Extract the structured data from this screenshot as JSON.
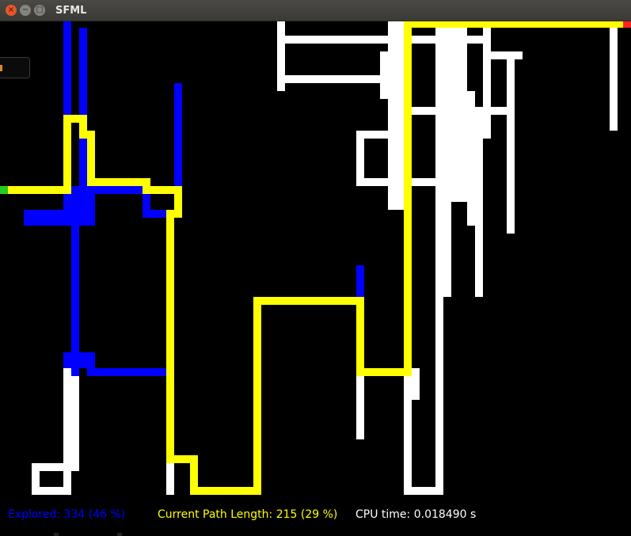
{
  "window": {
    "title": "SFML",
    "buttons": {
      "close": "×",
      "minimize": "−",
      "maximize": "□"
    }
  },
  "colors": {
    "wall": "#ffffff",
    "explored": "#0000ff",
    "path": "#ffff00",
    "start": "#22cc22",
    "goal": "#ff2222",
    "background": "#000000",
    "cpu_text": "#ffffff"
  },
  "status": {
    "explored": "Explored: 334 (46 %)",
    "path_length": "Current Path Length: 215 (29 %)",
    "cpu_time": "CPU time: 0.018490 s"
  }
}
